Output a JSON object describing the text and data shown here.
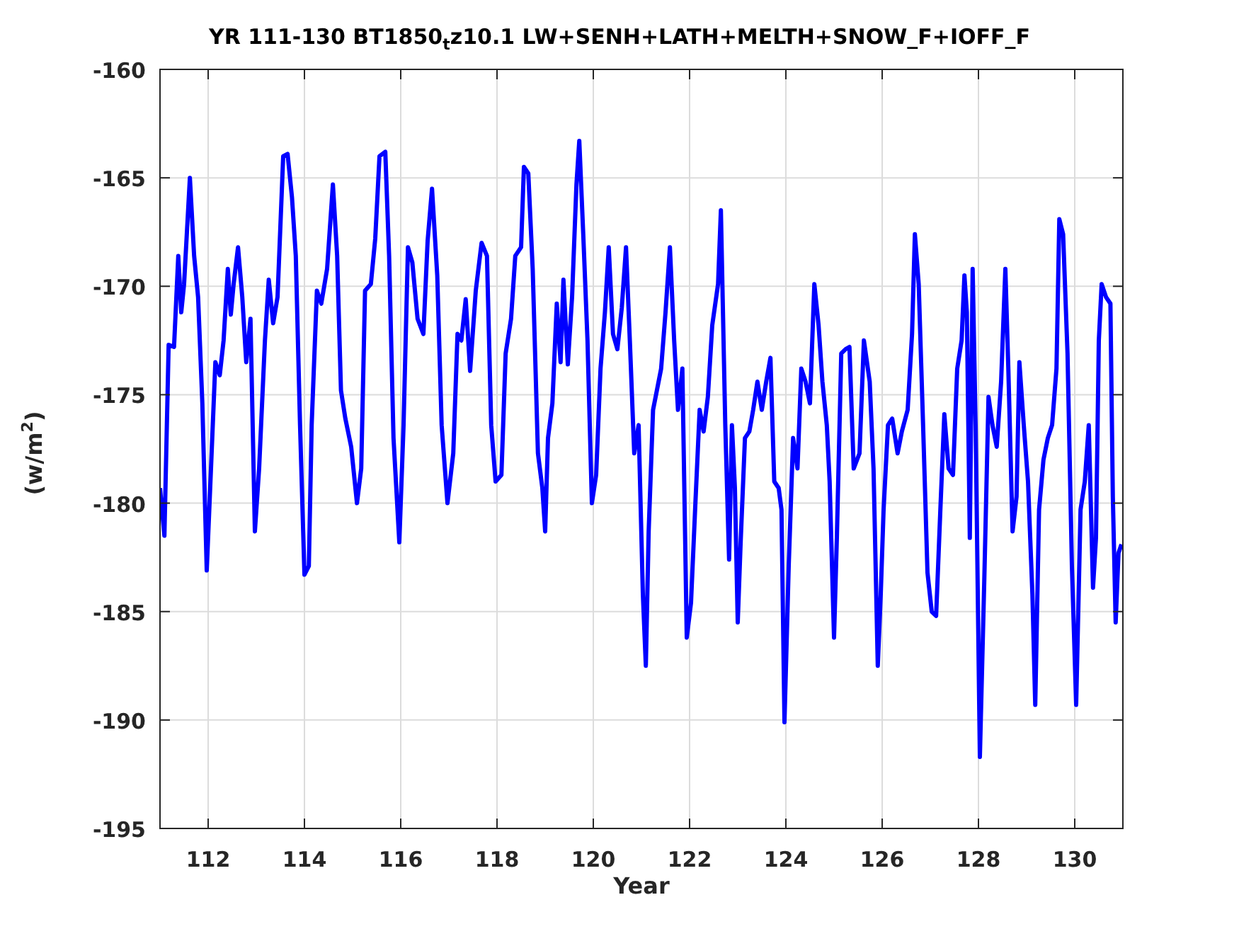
{
  "figure": {
    "chart_data": {
      "type": "line",
      "title": "YR 111-130 BT1850$_{t}$z10.1 LW+SENH+LATH+MELTH+SNOW_F+IOFF_F",
      "xlabel": "Year",
      "ylabel": "(w/m$^{2}$)",
      "grid": true,
      "xlim": [
        111,
        131
      ],
      "ylim": [
        -195,
        -160
      ],
      "xticks": [
        112,
        114,
        116,
        118,
        120,
        122,
        124,
        126,
        128,
        130
      ],
      "yticks": [
        -195,
        -190,
        -185,
        -180,
        -175,
        -170,
        -165,
        -160
      ],
      "x": [
        111.0,
        111.09,
        111.18,
        111.29,
        111.38,
        111.44,
        111.5,
        111.62,
        111.71,
        111.79,
        111.88,
        111.97,
        112.06,
        112.15,
        112.24,
        112.32,
        112.41,
        112.47,
        112.53,
        112.62,
        112.71,
        112.79,
        112.88,
        112.97,
        113.06,
        113.18,
        113.26,
        113.35,
        113.44,
        113.56,
        113.65,
        113.74,
        113.82,
        113.91,
        114.0,
        114.09,
        114.15,
        114.26,
        114.35,
        114.47,
        114.59,
        114.68,
        114.76,
        114.85,
        114.97,
        115.09,
        115.18,
        115.26,
        115.38,
        115.47,
        115.56,
        115.68,
        115.76,
        115.85,
        115.97,
        116.06,
        116.15,
        116.24,
        116.35,
        116.47,
        116.56,
        116.65,
        116.76,
        116.85,
        116.97,
        117.09,
        117.18,
        117.26,
        117.35,
        117.44,
        117.56,
        117.68,
        117.79,
        117.88,
        117.97,
        118.09,
        118.18,
        118.29,
        118.38,
        118.5,
        118.56,
        118.65,
        118.74,
        118.85,
        118.94,
        119.0,
        119.06,
        119.15,
        119.24,
        119.32,
        119.38,
        119.47,
        119.56,
        119.65,
        119.71,
        119.79,
        119.88,
        119.97,
        120.06,
        120.15,
        120.24,
        120.32,
        120.41,
        120.5,
        120.59,
        120.68,
        120.76,
        120.85,
        120.94,
        121.03,
        121.09,
        121.15,
        121.24,
        121.32,
        121.41,
        121.5,
        121.59,
        121.68,
        121.76,
        121.85,
        121.94,
        122.03,
        122.12,
        122.21,
        122.29,
        122.38,
        122.47,
        122.59,
        122.65,
        122.74,
        122.82,
        122.88,
        122.94,
        123.0,
        123.06,
        123.15,
        123.24,
        123.32,
        123.41,
        123.5,
        123.59,
        123.68,
        123.76,
        123.85,
        123.91,
        123.97,
        124.06,
        124.15,
        124.24,
        124.32,
        124.41,
        124.5,
        124.59,
        124.68,
        124.76,
        124.85,
        124.91,
        125.0,
        125.06,
        125.15,
        125.24,
        125.32,
        125.41,
        125.53,
        125.62,
        125.74,
        125.82,
        125.91,
        125.97,
        126.03,
        126.12,
        126.21,
        126.32,
        126.41,
        126.53,
        126.62,
        126.68,
        126.76,
        126.85,
        126.94,
        127.03,
        127.12,
        127.21,
        127.29,
        127.38,
        127.47,
        127.56,
        127.65,
        127.71,
        127.76,
        127.82,
        127.88,
        127.94,
        128.03,
        128.12,
        128.21,
        128.29,
        128.38,
        128.47,
        128.56,
        128.62,
        128.71,
        128.79,
        128.85,
        128.94,
        129.03,
        129.12,
        129.18,
        129.26,
        129.35,
        129.44,
        129.53,
        129.62,
        129.68,
        129.76,
        129.85,
        129.94,
        130.03,
        130.12,
        130.21,
        130.29,
        130.38,
        130.44,
        130.5,
        130.56,
        130.65,
        130.74,
        130.79,
        130.85,
        130.91,
        130.97
      ],
      "series": [
        {
          "color": "#0000ff",
          "values": [
            -179.3,
            -181.5,
            -172.7,
            -172.8,
            -168.6,
            -171.2,
            -169.9,
            -165.0,
            -168.6,
            -170.5,
            -175.4,
            -183.1,
            -178.4,
            -173.5,
            -174.1,
            -172.5,
            -169.2,
            -171.3,
            -169.9,
            -168.2,
            -170.5,
            -173.5,
            -171.5,
            -181.3,
            -178.4,
            -172.5,
            -169.7,
            -171.7,
            -170.5,
            -164.0,
            -163.9,
            -165.9,
            -168.6,
            -176.4,
            -183.3,
            -182.9,
            -176.4,
            -170.2,
            -170.8,
            -169.2,
            -165.3,
            -168.6,
            -174.8,
            -176.1,
            -177.4,
            -180.0,
            -178.4,
            -170.2,
            -169.9,
            -167.8,
            -164.0,
            -163.8,
            -168.6,
            -177.0,
            -181.8,
            -176.4,
            -168.2,
            -168.9,
            -171.5,
            -172.2,
            -167.9,
            -165.5,
            -169.5,
            -176.4,
            -180.0,
            -177.7,
            -172.2,
            -172.5,
            -170.6,
            -173.9,
            -170.2,
            -168.0,
            -168.6,
            -176.4,
            -179.0,
            -178.7,
            -173.1,
            -171.5,
            -168.6,
            -168.2,
            -164.5,
            -164.8,
            -169.2,
            -177.7,
            -179.3,
            -181.3,
            -177.0,
            -175.4,
            -170.8,
            -173.5,
            -169.7,
            -173.6,
            -170.5,
            -165.3,
            -163.3,
            -167.6,
            -172.5,
            -180.0,
            -178.7,
            -173.8,
            -171.2,
            -168.2,
            -172.2,
            -172.9,
            -171.0,
            -168.2,
            -172.5,
            -177.7,
            -176.4,
            -184.2,
            -187.5,
            -181.3,
            -175.7,
            -174.8,
            -173.8,
            -171.2,
            -168.2,
            -172.5,
            -175.7,
            -173.8,
            -186.2,
            -184.6,
            -180.0,
            -175.7,
            -176.7,
            -175.1,
            -171.8,
            -169.9,
            -166.5,
            -176.4,
            -182.6,
            -176.4,
            -179.3,
            -185.5,
            -181.9,
            -177.0,
            -176.7,
            -175.7,
            -174.4,
            -175.7,
            -174.4,
            -173.3,
            -179.0,
            -179.3,
            -180.3,
            -190.1,
            -182.9,
            -177.0,
            -178.4,
            -173.8,
            -174.4,
            -175.4,
            -169.9,
            -171.8,
            -174.4,
            -176.4,
            -179.0,
            -186.2,
            -181.6,
            -173.1,
            -172.9,
            -172.8,
            -178.4,
            -177.7,
            -172.5,
            -174.4,
            -178.4,
            -187.5,
            -184.2,
            -180.3,
            -176.4,
            -176.1,
            -177.7,
            -176.7,
            -175.7,
            -172.2,
            -167.6,
            -169.9,
            -176.4,
            -183.2,
            -185.0,
            -185.2,
            -180.3,
            -175.9,
            -178.4,
            -178.7,
            -173.8,
            -172.5,
            -169.5,
            -171.2,
            -181.6,
            -169.2,
            -176.4,
            -191.7,
            -183.6,
            -175.1,
            -176.4,
            -177.4,
            -174.4,
            -169.2,
            -173.8,
            -181.3,
            -179.7,
            -173.5,
            -176.4,
            -179.0,
            -184.2,
            -189.3,
            -180.3,
            -178.0,
            -177.0,
            -176.4,
            -173.8,
            -166.9,
            -167.6,
            -173.1,
            -182.9,
            -189.3,
            -180.3,
            -179.0,
            -176.4,
            -183.9,
            -181.6,
            -172.5,
            -169.9,
            -170.5,
            -170.8,
            -179.7,
            -185.5,
            -182.3,
            -181.9
          ]
        }
      ]
    }
  }
}
